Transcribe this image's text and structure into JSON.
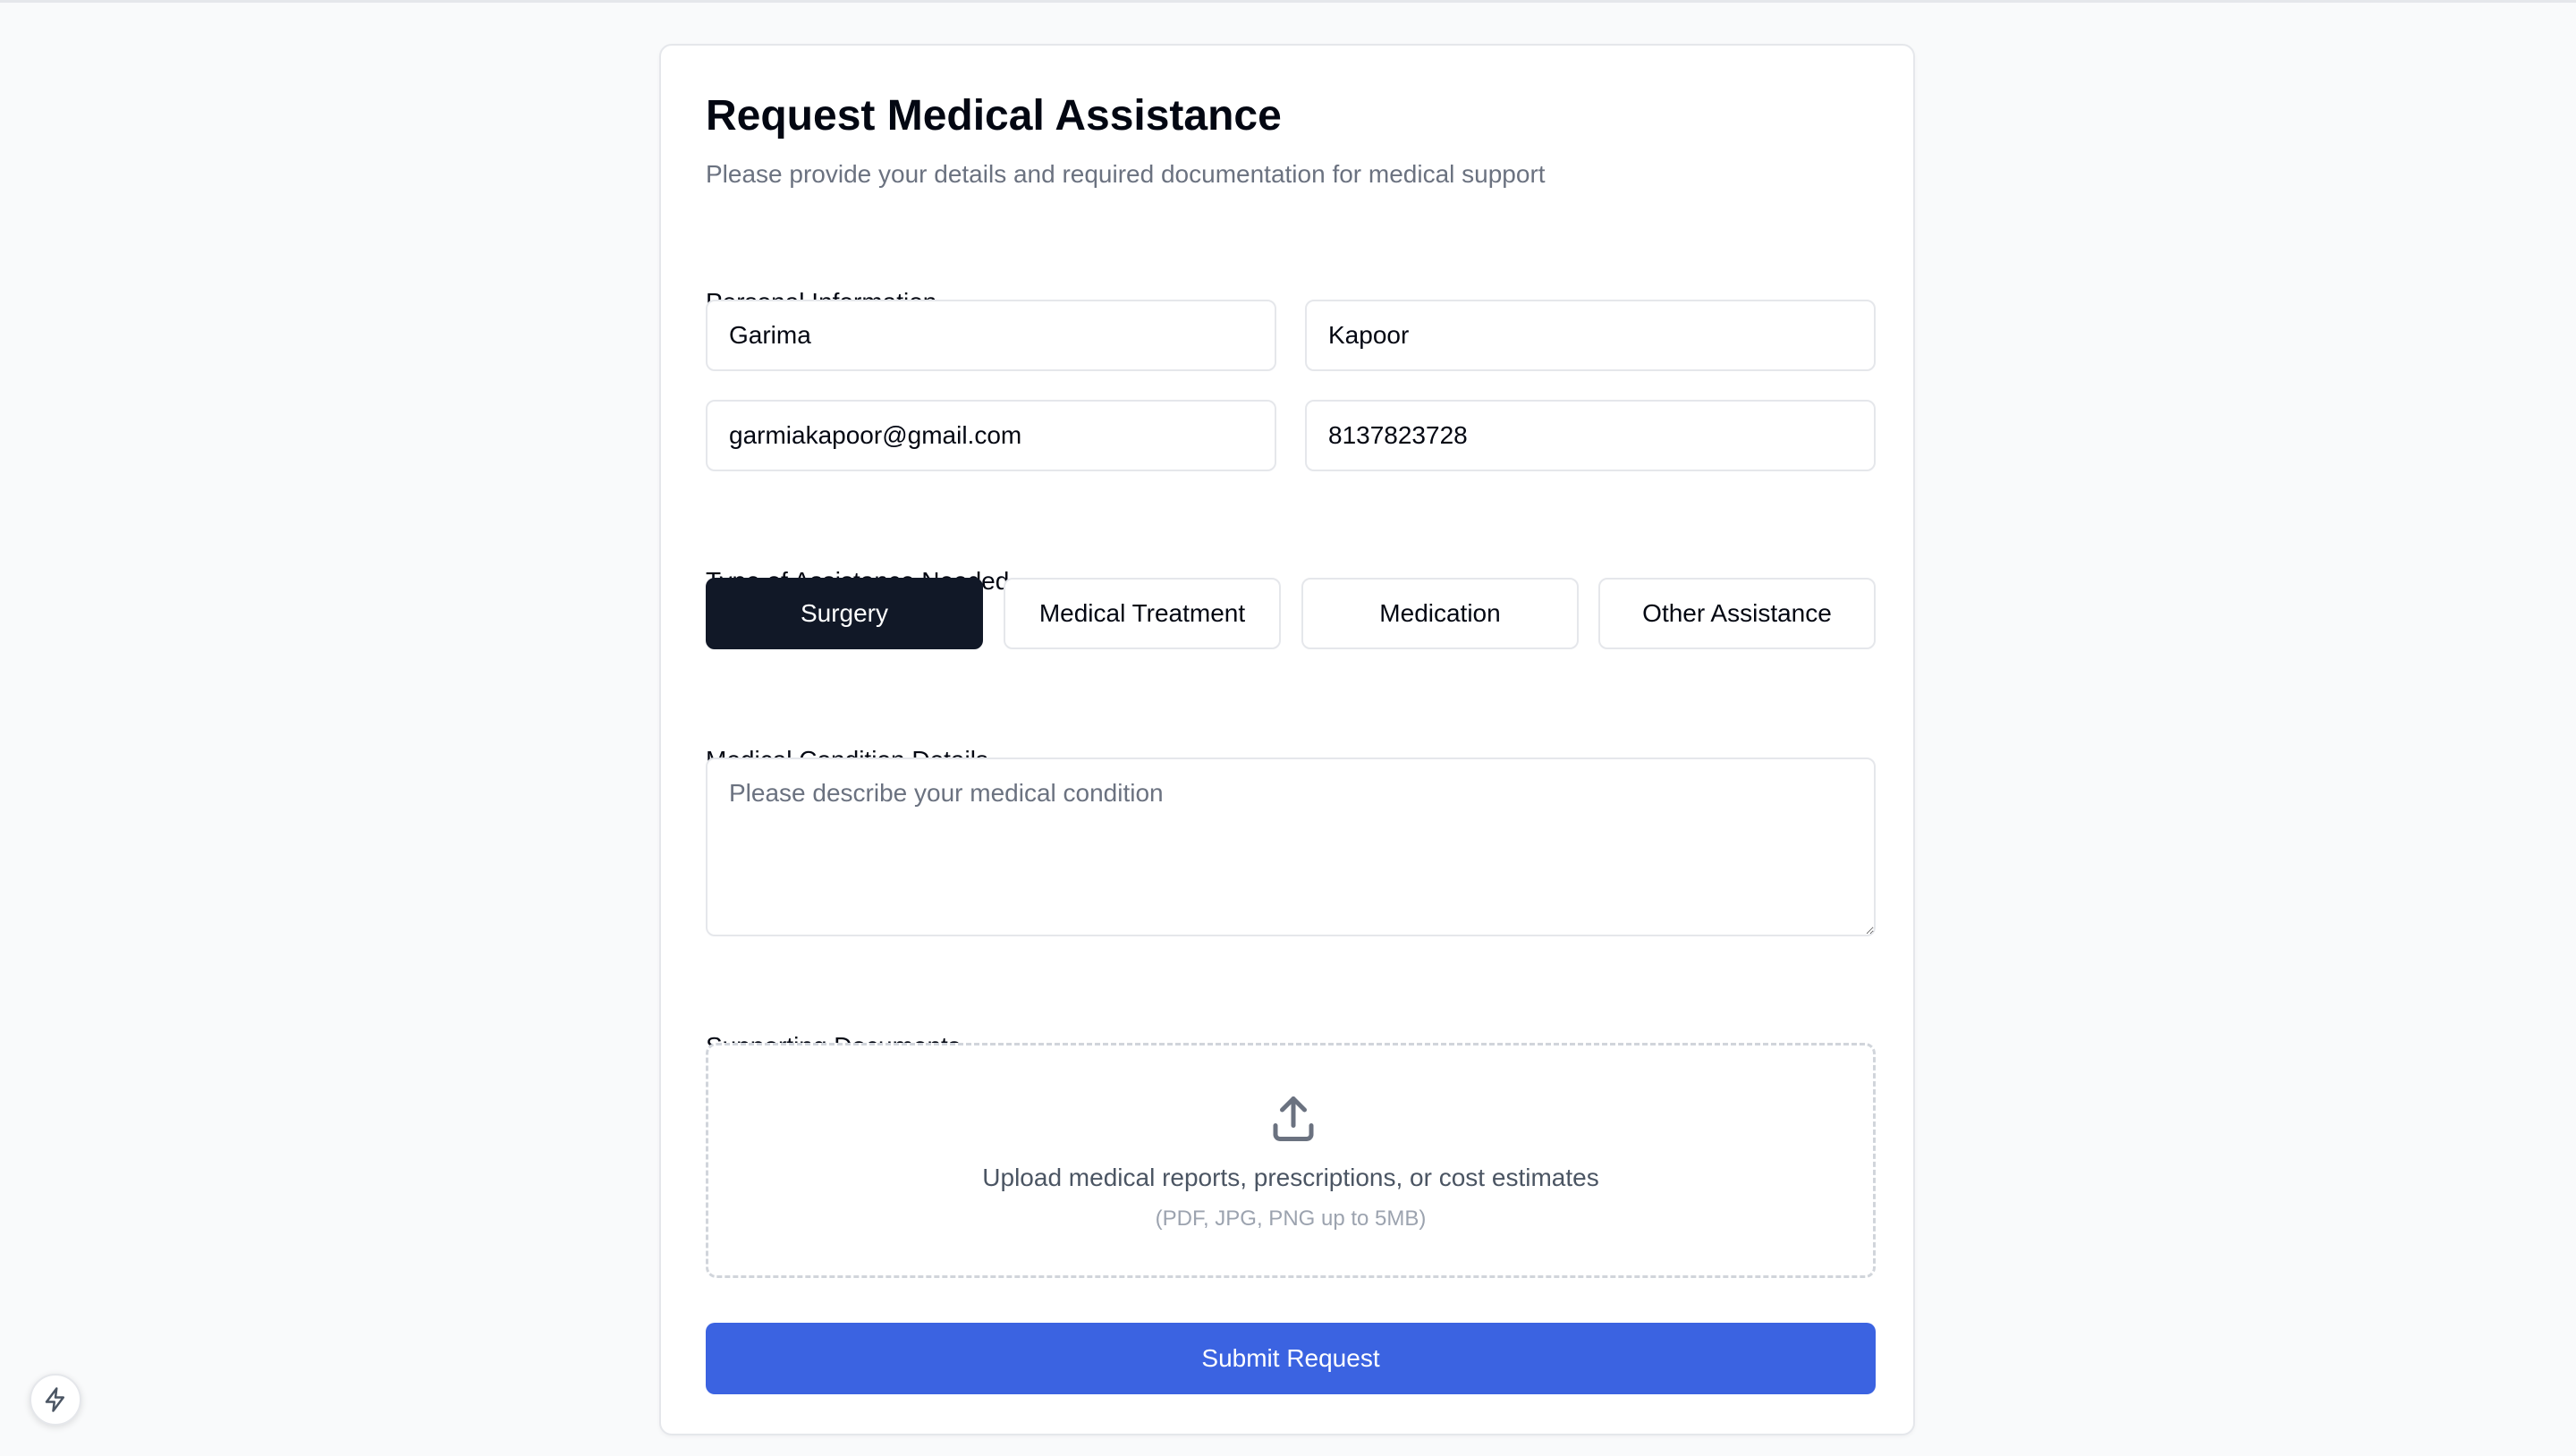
{
  "form": {
    "title": "Request Medical Assistance",
    "subtitle": "Please provide your details and required documentation for medical support"
  },
  "personal_info": {
    "label": "Personal Information",
    "first_name": "Garima",
    "last_name": "Kapoor",
    "email": "garmiakapoor@gmail.com",
    "phone": "8137823728"
  },
  "assistance_type": {
    "label": "Type of Assistance Needed",
    "options": [
      "Surgery",
      "Medical Treatment",
      "Medication",
      "Other Assistance"
    ],
    "selected": "Surgery"
  },
  "condition": {
    "label": "Medical Condition Details",
    "placeholder": "Please describe your medical condition",
    "value": ""
  },
  "documents": {
    "label": "Supporting Documents",
    "upload_text": "Upload medical reports, prescriptions, or cost estimates",
    "upload_hint": "(PDF, JPG, PNG up to 5MB)",
    "icon": "upload-icon"
  },
  "submit_label": "Submit Request",
  "floating_button": {
    "icon": "lightning-bolt-icon"
  },
  "colors": {
    "background": "#f9fafb",
    "selected_option": "#111827",
    "submit_button": "#3b63e1",
    "border": "#e5e7eb",
    "muted_text": "#6b7280"
  }
}
